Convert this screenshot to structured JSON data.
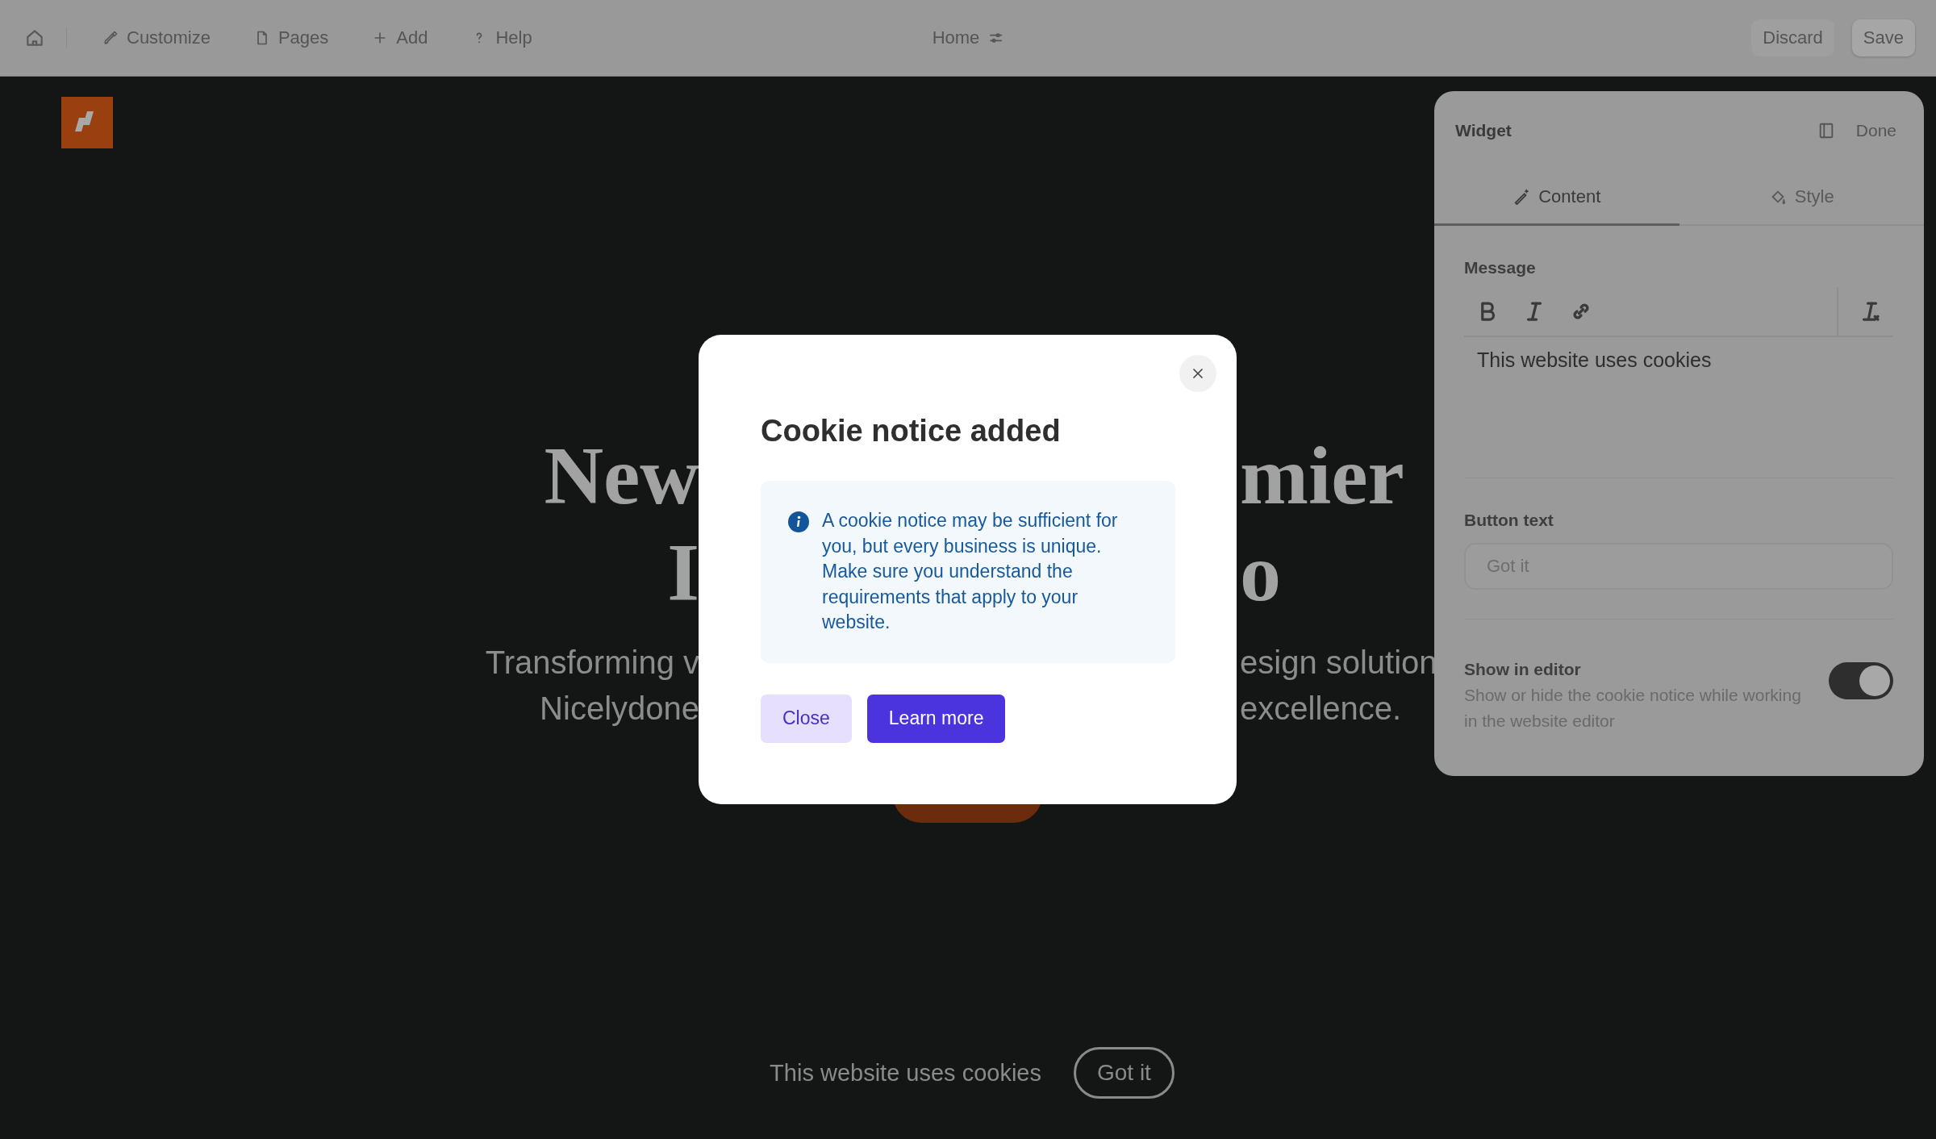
{
  "toolbar": {
    "items": [
      {
        "label": "Customize"
      },
      {
        "label": "Pages"
      },
      {
        "label": "Add"
      },
      {
        "label": "Help"
      }
    ],
    "page": "Home",
    "actions": [
      {
        "label": "Discard"
      },
      {
        "label": "Save"
      }
    ]
  },
  "hero": {
    "title_lines": [
      {
        "left": "New",
        "right": "mier"
      },
      {
        "left": "I",
        "right": "o"
      }
    ],
    "subtitle_lines": [
      {
        "left": "Transforming v",
        "right": "esign solution"
      },
      {
        "left": "Nicelydone",
        "right": "excellence."
      }
    ]
  },
  "cookie_banner": {
    "message": "This website uses cookies",
    "button": "Got it"
  },
  "widget_panel": {
    "title": "Widget",
    "done": "Done",
    "tabs": [
      {
        "label": "Content",
        "selected": true
      },
      {
        "label": "Style",
        "selected": false
      }
    ],
    "message_label": "Message",
    "message": "This website uses cookies",
    "button_text_label": "Button text",
    "button_text_placeholder": "Got it",
    "show_in_editor": {
      "label": "Show in editor",
      "description": "Show or hide the cookie notice while working in the website editor",
      "on": true
    }
  },
  "modal": {
    "title": "Cookie notice added",
    "info": "A cookie notice may be sufficient for you, but every business is unique. Make sure you understand the requirements that apply to your website.",
    "buttons": [
      {
        "label": "Close",
        "kind": "secondary"
      },
      {
        "label": "Learn more",
        "kind": "primary"
      }
    ]
  }
}
